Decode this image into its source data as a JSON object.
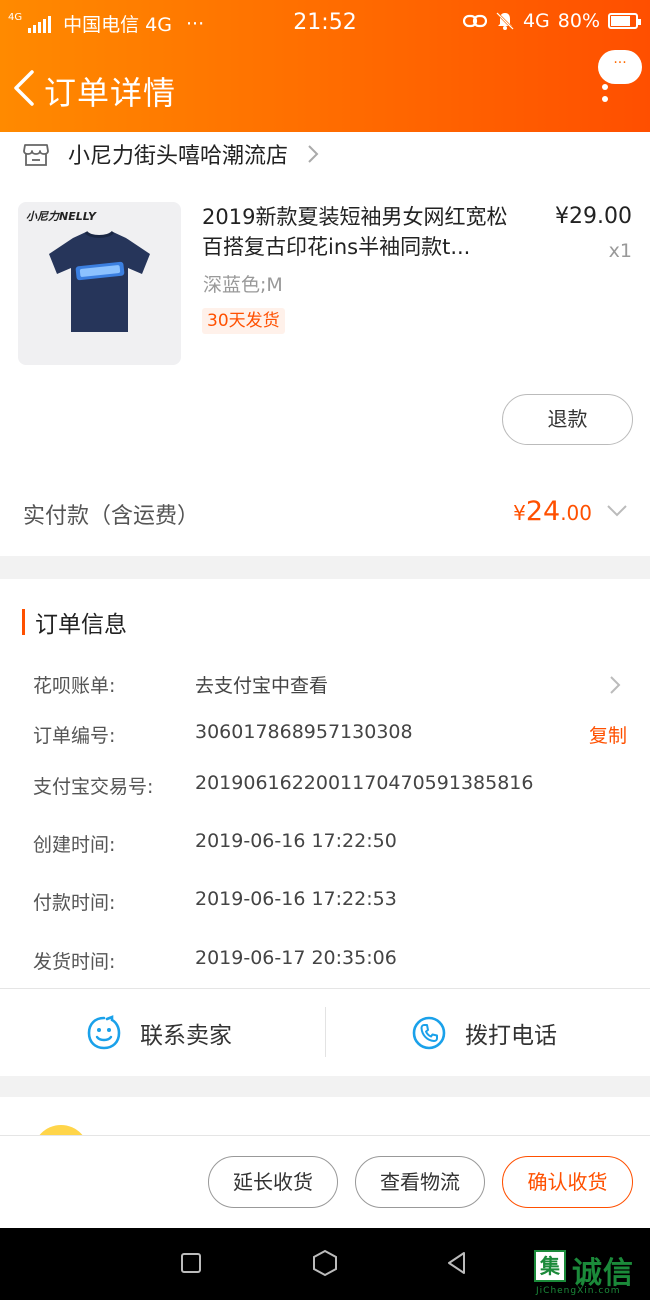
{
  "status_bar": {
    "network_badge": "4G",
    "carrier": "中国电信 4G",
    "more": "···",
    "time": "21:52",
    "data_type": "4G",
    "battery": "80%",
    "battery_level": 0.8
  },
  "nav": {
    "title": "订单详情",
    "more_bubble": "···"
  },
  "shop": {
    "name": "小尼力街头嘻哈潮流店"
  },
  "product": {
    "brand": "小尼力NELLY",
    "title": "2019新款夏装短袖男女网红宽松百搭复古印花ins半袖同款t...",
    "price": "¥29.00",
    "quantity": "x1",
    "sku": "深蓝色;M",
    "shipping_badge": "30天发货",
    "refund_label": "退款"
  },
  "payment": {
    "label": "实付款（含运费）",
    "currency": "¥",
    "amount_int": "24",
    "amount_dec": ".00"
  },
  "order_info": {
    "heading": "订单信息",
    "rows": [
      {
        "key": "花呗账单:",
        "value": "去支付宝中查看"
      },
      {
        "key": "订单编号:",
        "value": "306017868957130308",
        "action": "复制"
      },
      {
        "key": "支付宝交易号:",
        "value": "2019061622001170470591385816"
      },
      {
        "key": "创建时间:",
        "value": "2019-06-16 17:22:50"
      },
      {
        "key": "付款时间:",
        "value": "2019-06-16 17:22:53"
      },
      {
        "key": "发货时间:",
        "value": "2019-06-17 20:35:06"
      }
    ],
    "contact_seller": "联系卖家",
    "call_phone": "拨打电话"
  },
  "actions": {
    "extend": "延长收货",
    "logistics": "查看物流",
    "confirm": "确认收货"
  },
  "watermark": {
    "box": "集",
    "text": "诚信",
    "sub": "JiChengXin.com"
  },
  "colors": {
    "accent": "#ff5000",
    "header_start": "#ff8a00",
    "header_end": "#ff4f00",
    "contact_icon": "#1aa1ea",
    "watermark": "#1b8a3a"
  }
}
